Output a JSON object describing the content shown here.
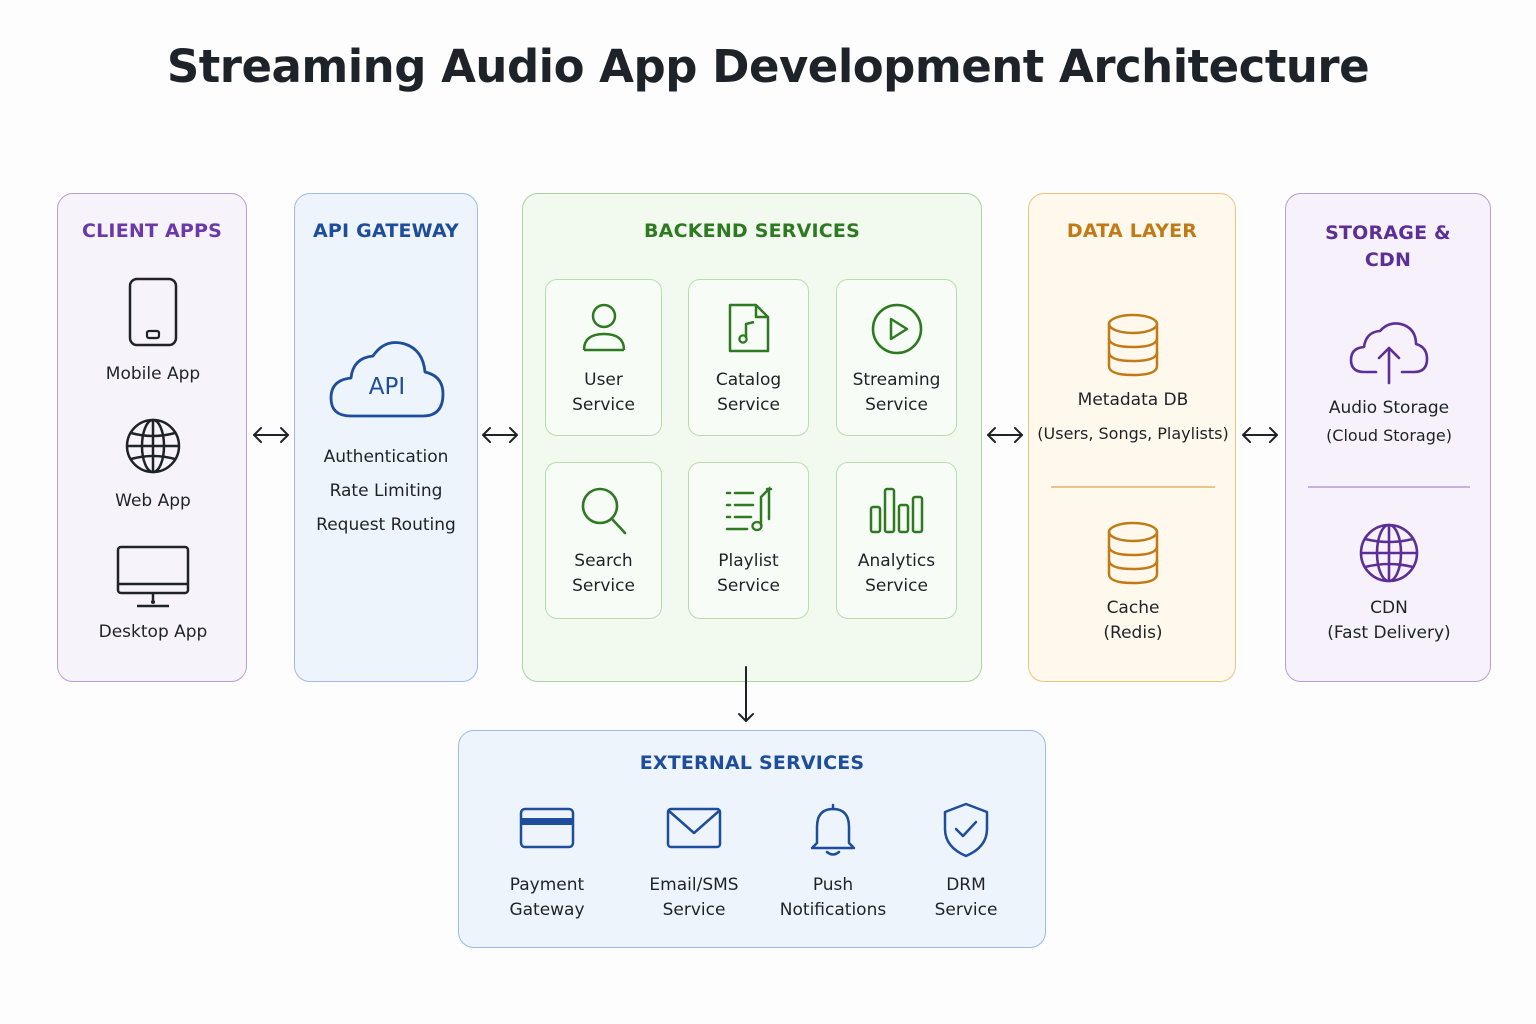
{
  "title": "Streaming Audio App Development Architecture",
  "colors": {
    "client": "#6a3aa8",
    "gateway": "#1e4d9b",
    "backend": "#2e7a22",
    "data": "#c17a16",
    "storage": "#5c2f96"
  },
  "client_apps": {
    "title": "CLIENT APPS",
    "items": [
      {
        "label": "Mobile App",
        "icon": "smartphone-icon"
      },
      {
        "label": "Web App",
        "icon": "globe-icon"
      },
      {
        "label": "Desktop App",
        "icon": "monitor-icon"
      }
    ]
  },
  "api_gateway": {
    "title": "API GATEWAY",
    "icon_text": "API",
    "features": [
      "Authentication",
      "Rate Limiting",
      "Request Routing"
    ]
  },
  "backend_services": {
    "title": "BACKEND SERVICES",
    "services": [
      {
        "line1": "User",
        "line2": "Service",
        "icon": "user-icon"
      },
      {
        "line1": "Catalog",
        "line2": "Service",
        "icon": "music-file-icon"
      },
      {
        "line1": "Streaming",
        "line2": "Service",
        "icon": "play-icon"
      },
      {
        "line1": "Search",
        "line2": "Service",
        "icon": "search-icon"
      },
      {
        "line1": "Playlist",
        "line2": "Service",
        "icon": "playlist-icon"
      },
      {
        "line1": "Analytics",
        "line2": "Service",
        "icon": "bar-chart-icon"
      }
    ]
  },
  "data_layer": {
    "title": "DATA LAYER",
    "items": [
      {
        "line1": "Metadata DB",
        "line2": "(Users, Songs, Playlists)",
        "icon": "database-icon"
      },
      {
        "line1": "Cache",
        "line2": "(Redis)",
        "icon": "database-icon"
      }
    ]
  },
  "storage_cdn": {
    "title_line1": "STORAGE &",
    "title_line2": "CDN",
    "items": [
      {
        "line1": "Audio Storage",
        "line2": "(Cloud Storage)",
        "icon": "cloud-upload-icon"
      },
      {
        "line1": "CDN",
        "line2": "(Fast Delivery)",
        "icon": "globe-icon"
      }
    ]
  },
  "external_services": {
    "title": "EXTERNAL SERVICES",
    "services": [
      {
        "line1": "Payment",
        "line2": "Gateway",
        "icon": "credit-card-icon"
      },
      {
        "line1": "Email/SMS",
        "line2": "Service",
        "icon": "mail-icon"
      },
      {
        "line1": "Push",
        "line2": "Notifications",
        "icon": "bell-icon"
      },
      {
        "line1": "DRM",
        "line2": "Service",
        "icon": "shield-check-icon"
      }
    ]
  }
}
